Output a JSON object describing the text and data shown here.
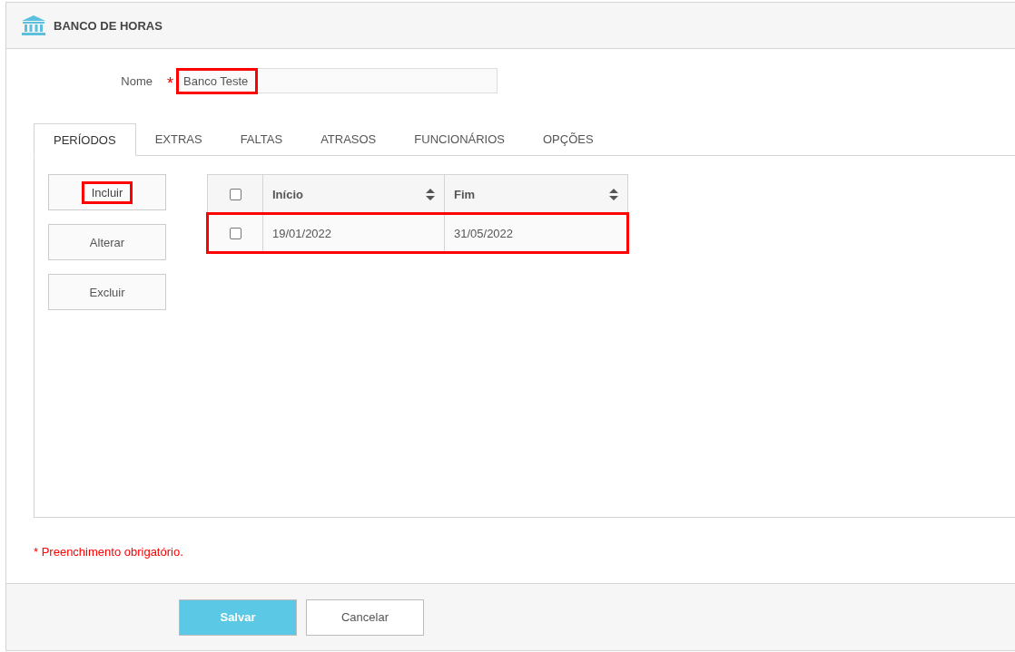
{
  "header": {
    "title": "BANCO DE HORAS"
  },
  "name_field": {
    "label": "Nome",
    "required_mark": "*",
    "value": "Banco Teste",
    "highlighted": true
  },
  "tabs": [
    {
      "label": "PERÍODOS",
      "selected": true
    },
    {
      "label": "EXTRAS",
      "selected": false
    },
    {
      "label": "FALTAS",
      "selected": false
    },
    {
      "label": "ATRASOS",
      "selected": false
    },
    {
      "label": "FUNCIONÁRIOS",
      "selected": false
    },
    {
      "label": "OPÇÕES",
      "selected": false
    }
  ],
  "actions": [
    {
      "label": "Incluir",
      "highlighted": true
    },
    {
      "label": "Alterar",
      "highlighted": false
    },
    {
      "label": "Excluir",
      "highlighted": false
    }
  ],
  "table": {
    "header_checked": false,
    "columns": [
      "Início",
      "Fim"
    ],
    "rows": [
      {
        "checked": false,
        "highlighted": true,
        "cells": [
          "19/01/2022",
          "31/05/2022"
        ]
      }
    ]
  },
  "required_note": "* Preenchimento obrigatório.",
  "footer_buttons": [
    {
      "label": "Salvar",
      "kind": "primary"
    },
    {
      "label": "Cancelar",
      "kind": "secondary"
    }
  ]
}
